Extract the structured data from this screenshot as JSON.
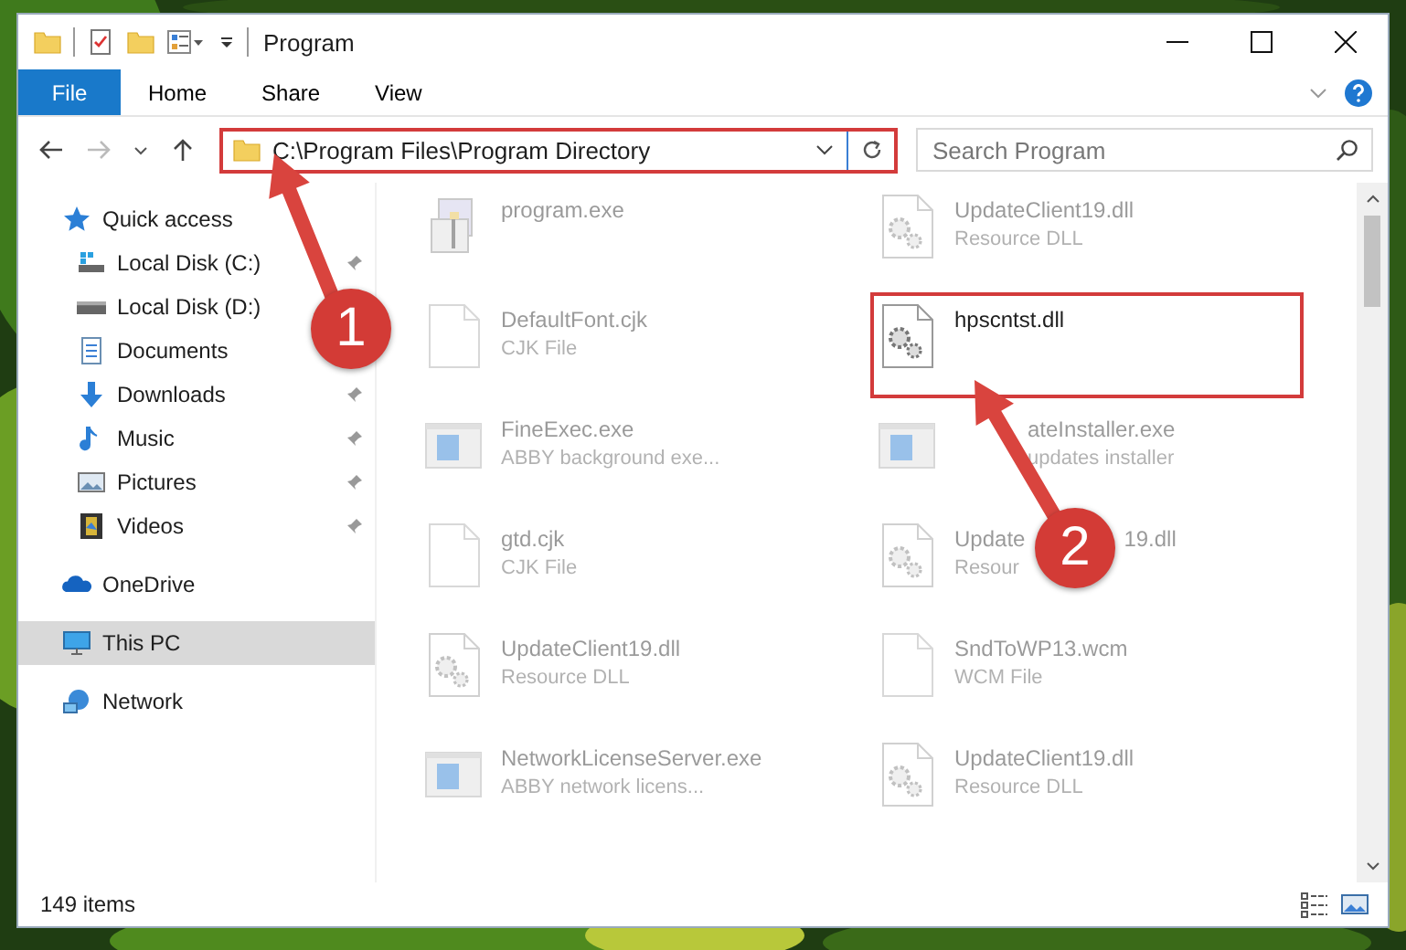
{
  "window": {
    "title": "Program"
  },
  "ribbon": {
    "file_menu": "File",
    "tabs": [
      "Home",
      "Share",
      "View"
    ]
  },
  "address": {
    "path": "C:\\Program Files\\Program Directory",
    "marked": true
  },
  "search": {
    "placeholder": "Search Program"
  },
  "sidebar": {
    "items": [
      {
        "label": "Quick access",
        "kind": "star",
        "selected": false,
        "children": [
          {
            "label": "Local Disk (C:)",
            "kind": "disk-c",
            "selected": false,
            "pinned": true
          },
          {
            "label": "Local Disk (D:)",
            "kind": "disk",
            "selected": false
          },
          {
            "label": "Documents",
            "kind": "documents",
            "selected": false
          },
          {
            "label": "Downloads",
            "kind": "downloads",
            "selected": false,
            "pinned": true
          },
          {
            "label": "Music",
            "kind": "music",
            "selected": false,
            "pinned": true
          },
          {
            "label": "Pictures",
            "kind": "pictures",
            "selected": false,
            "pinned": true
          },
          {
            "label": "Videos",
            "kind": "videos",
            "selected": false,
            "pinned": true
          }
        ]
      },
      {
        "label": "OneDrive",
        "kind": "cloud",
        "selected": false
      },
      {
        "label": "This PC",
        "kind": "pc",
        "selected": true
      },
      {
        "label": "Network",
        "kind": "network",
        "selected": false
      }
    ]
  },
  "files": [
    {
      "name": "program.exe",
      "kind": "setup",
      "faded": true,
      "marked": false
    },
    {
      "name": "UpdateClient19.dll",
      "type": "Resource DLL",
      "kind": "gear",
      "faded": true,
      "marked": false
    },
    {
      "name": "DefaultFont.cjk",
      "type": "CJK File",
      "kind": "blank",
      "faded": true,
      "marked": false
    },
    {
      "name": "hpscntst.dll",
      "kind": "gear",
      "faded": false,
      "marked": true
    },
    {
      "name": "FineExec.exe",
      "type": "ABBY background exe...",
      "kind": "window",
      "faded": true,
      "marked": false
    },
    {
      "name": "ateInstaller.exe",
      "type": "updates installer",
      "kind": "window",
      "faded": true,
      "marked": false,
      "partial": true
    },
    {
      "name": "gtd.cjk",
      "type": "CJK File",
      "kind": "blank",
      "faded": true,
      "marked": false
    },
    {
      "name": "Update",
      "name_tail": "19.dll",
      "type": "Resour",
      "kind": "gear",
      "faded": true,
      "marked": false
    },
    {
      "name": "UpdateClient19.dll",
      "type": "Resource DLL",
      "kind": "gear",
      "faded": true,
      "marked": false
    },
    {
      "name": "SndToWP13.wcm",
      "type": "WCM File",
      "kind": "blank",
      "faded": true,
      "marked": false
    },
    {
      "name": "NetworkLicenseServer.exe",
      "type": "ABBY network licens...",
      "kind": "window",
      "faded": true,
      "marked": false
    },
    {
      "name": "UpdateClient19.dll",
      "type": "Resource DLL",
      "kind": "gear",
      "faded": true,
      "marked": false
    }
  ],
  "status_bar": {
    "count": "149 items"
  },
  "annotations": [
    {
      "label": "1"
    },
    {
      "label": "2"
    }
  ]
}
